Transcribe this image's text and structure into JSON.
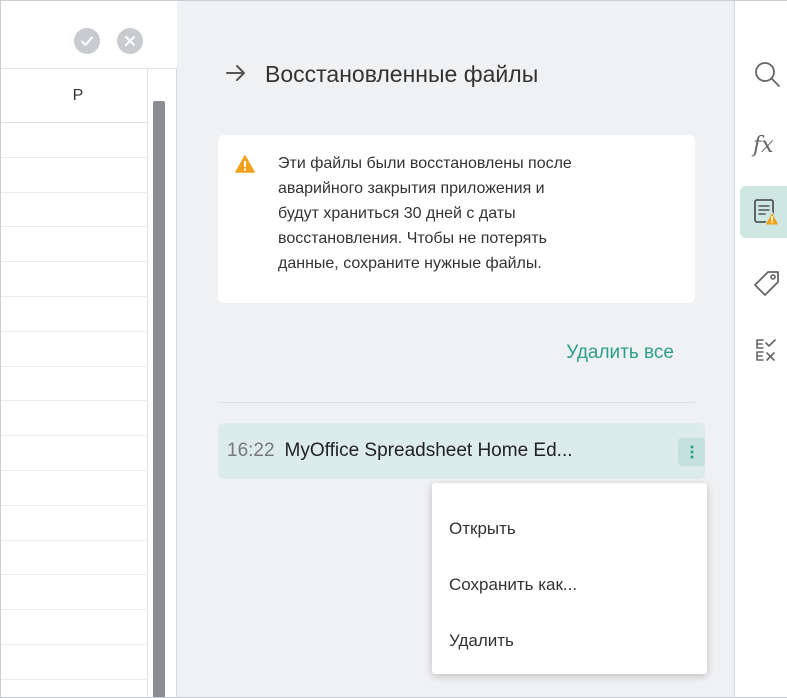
{
  "sheet": {
    "column_label": "P",
    "confirm_icon": "check-icon",
    "cancel_icon": "close-icon"
  },
  "panel": {
    "title": "Восстановленные файлы",
    "back_icon": "arrow-right-icon",
    "warning_lines": [
      "Эти файлы были восстановлены после",
      "аварийного закрытия приложения и",
      "будут храниться 30 дней с даты",
      "восстановления. Чтобы не потерять",
      "данные, сохраните нужные файлы."
    ],
    "delete_all_label": "Удалить все",
    "file": {
      "time": "16:22",
      "name": "MyOffice Spreadsheet Home Ed..."
    },
    "menu": {
      "open": "Открыть",
      "save_as": "Сохранить как...",
      "delete": "Удалить"
    }
  },
  "sidebar": {
    "items": [
      "search-icon",
      "fx-icon",
      "recovered-files-icon",
      "tag-icon",
      "review-icon"
    ],
    "fx_label": "fx"
  },
  "colors": {
    "accent": "#2c9f8c",
    "warning": "#f0a21c",
    "panel_bg": "#f0f1f3",
    "selected_bg": "#dcecea"
  }
}
